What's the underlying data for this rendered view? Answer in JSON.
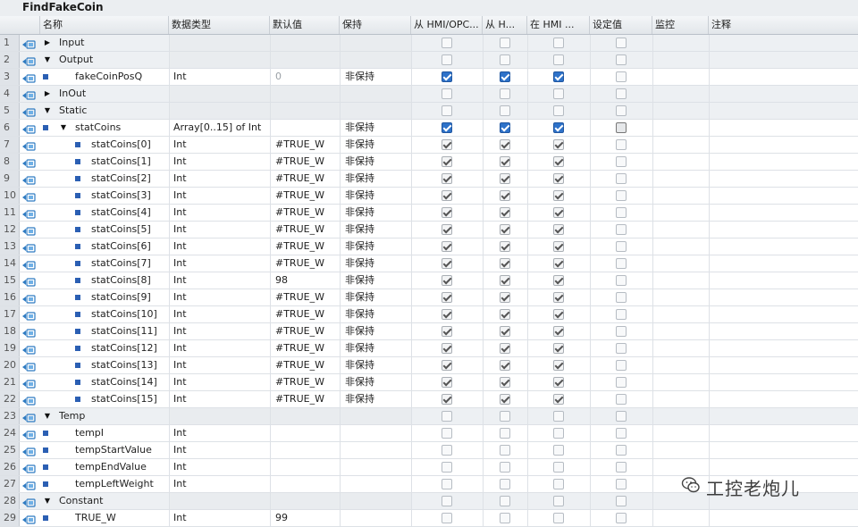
{
  "block_title": "FindFakeCoin",
  "headers": {
    "name": "名称",
    "data_type": "数据类型",
    "default": "默认值",
    "retain": "保持",
    "hmi_opc": "从 HMI/OPC...",
    "from_h": "从 H...",
    "in_hmi": "在 HMI ...",
    "setpoint": "设定值",
    "monitor": "监控",
    "comment": "注释"
  },
  "rows": [
    {
      "num": "1",
      "kind": "section",
      "toggle": "right",
      "name": "Input",
      "indent": 0,
      "type": "",
      "default": "",
      "retain": "",
      "hmi": "off",
      "fromh": "off",
      "inhmi": "off",
      "setpoint": "off"
    },
    {
      "num": "2",
      "kind": "section",
      "toggle": "down",
      "name": "Output",
      "indent": 0,
      "type": "",
      "default": "",
      "retain": "",
      "hmi": "off",
      "fromh": "off",
      "inhmi": "off",
      "setpoint": "off"
    },
    {
      "num": "3",
      "kind": "var",
      "toggle": "",
      "name": "fakeCoinPosQ",
      "indent": 1,
      "type": "Int",
      "default": "0",
      "default_grey": true,
      "retain": "非保持",
      "hmi": "on",
      "fromh": "on",
      "inhmi": "on",
      "setpoint": "off"
    },
    {
      "num": "4",
      "kind": "section",
      "toggle": "right",
      "name": "InOut",
      "indent": 0,
      "type": "",
      "default": "",
      "retain": "",
      "hmi": "off",
      "fromh": "off",
      "inhmi": "off",
      "setpoint": "off"
    },
    {
      "num": "5",
      "kind": "section",
      "toggle": "down",
      "name": "Static",
      "indent": 0,
      "type": "",
      "default": "",
      "retain": "",
      "hmi": "off",
      "fromh": "off",
      "inhmi": "off",
      "setpoint": "off"
    },
    {
      "num": "6",
      "kind": "var",
      "toggle": "down",
      "name": "statCoins",
      "indent": 1,
      "type": "Array[0..15] of Int",
      "default": "",
      "retain": "非保持",
      "hmi": "on",
      "fromh": "on",
      "inhmi": "on",
      "setpoint": "dark"
    },
    {
      "num": "7",
      "kind": "elem",
      "toggle": "",
      "name": "statCoins[0]",
      "indent": 2,
      "type": "Int",
      "default": "#TRUE_W",
      "retain": "非保持",
      "hmi": "grey",
      "fromh": "grey",
      "inhmi": "grey",
      "setpoint": "off"
    },
    {
      "num": "8",
      "kind": "elem",
      "toggle": "",
      "name": "statCoins[1]",
      "indent": 2,
      "type": "Int",
      "default": "#TRUE_W",
      "retain": "非保持",
      "hmi": "grey",
      "fromh": "grey",
      "inhmi": "grey",
      "setpoint": "off"
    },
    {
      "num": "9",
      "kind": "elem",
      "toggle": "",
      "name": "statCoins[2]",
      "indent": 2,
      "type": "Int",
      "default": "#TRUE_W",
      "retain": "非保持",
      "hmi": "grey",
      "fromh": "grey",
      "inhmi": "grey",
      "setpoint": "off"
    },
    {
      "num": "10",
      "kind": "elem",
      "toggle": "",
      "name": "statCoins[3]",
      "indent": 2,
      "type": "Int",
      "default": "#TRUE_W",
      "retain": "非保持",
      "hmi": "grey",
      "fromh": "grey",
      "inhmi": "grey",
      "setpoint": "off"
    },
    {
      "num": "11",
      "kind": "elem",
      "toggle": "",
      "name": "statCoins[4]",
      "indent": 2,
      "type": "Int",
      "default": "#TRUE_W",
      "retain": "非保持",
      "hmi": "grey",
      "fromh": "grey",
      "inhmi": "grey",
      "setpoint": "off"
    },
    {
      "num": "12",
      "kind": "elem",
      "toggle": "",
      "name": "statCoins[5]",
      "indent": 2,
      "type": "Int",
      "default": "#TRUE_W",
      "retain": "非保持",
      "hmi": "grey",
      "fromh": "grey",
      "inhmi": "grey",
      "setpoint": "off"
    },
    {
      "num": "13",
      "kind": "elem",
      "toggle": "",
      "name": "statCoins[6]",
      "indent": 2,
      "type": "Int",
      "default": "#TRUE_W",
      "retain": "非保持",
      "hmi": "grey",
      "fromh": "grey",
      "inhmi": "grey",
      "setpoint": "off"
    },
    {
      "num": "14",
      "kind": "elem",
      "toggle": "",
      "name": "statCoins[7]",
      "indent": 2,
      "type": "Int",
      "default": "#TRUE_W",
      "retain": "非保持",
      "hmi": "grey",
      "fromh": "grey",
      "inhmi": "grey",
      "setpoint": "off"
    },
    {
      "num": "15",
      "kind": "elem",
      "toggle": "",
      "name": "statCoins[8]",
      "indent": 2,
      "type": "Int",
      "default": "98",
      "retain": "非保持",
      "hmi": "grey",
      "fromh": "grey",
      "inhmi": "grey",
      "setpoint": "off"
    },
    {
      "num": "16",
      "kind": "elem",
      "toggle": "",
      "name": "statCoins[9]",
      "indent": 2,
      "type": "Int",
      "default": "#TRUE_W",
      "retain": "非保持",
      "hmi": "grey",
      "fromh": "grey",
      "inhmi": "grey",
      "setpoint": "off"
    },
    {
      "num": "17",
      "kind": "elem",
      "toggle": "",
      "name": "statCoins[10]",
      "indent": 2,
      "type": "Int",
      "default": "#TRUE_W",
      "retain": "非保持",
      "hmi": "grey",
      "fromh": "grey",
      "inhmi": "grey",
      "setpoint": "off"
    },
    {
      "num": "18",
      "kind": "elem",
      "toggle": "",
      "name": "statCoins[11]",
      "indent": 2,
      "type": "Int",
      "default": "#TRUE_W",
      "retain": "非保持",
      "hmi": "grey",
      "fromh": "grey",
      "inhmi": "grey",
      "setpoint": "off"
    },
    {
      "num": "19",
      "kind": "elem",
      "toggle": "",
      "name": "statCoins[12]",
      "indent": 2,
      "type": "Int",
      "default": "#TRUE_W",
      "retain": "非保持",
      "hmi": "grey",
      "fromh": "grey",
      "inhmi": "grey",
      "setpoint": "off"
    },
    {
      "num": "20",
      "kind": "elem",
      "toggle": "",
      "name": "statCoins[13]",
      "indent": 2,
      "type": "Int",
      "default": "#TRUE_W",
      "retain": "非保持",
      "hmi": "grey",
      "fromh": "grey",
      "inhmi": "grey",
      "setpoint": "off"
    },
    {
      "num": "21",
      "kind": "elem",
      "toggle": "",
      "name": "statCoins[14]",
      "indent": 2,
      "type": "Int",
      "default": "#TRUE_W",
      "retain": "非保持",
      "hmi": "grey",
      "fromh": "grey",
      "inhmi": "grey",
      "setpoint": "off"
    },
    {
      "num": "22",
      "kind": "elem",
      "toggle": "",
      "name": "statCoins[15]",
      "indent": 2,
      "type": "Int",
      "default": "#TRUE_W",
      "retain": "非保持",
      "hmi": "grey",
      "fromh": "grey",
      "inhmi": "grey",
      "setpoint": "off"
    },
    {
      "num": "23",
      "kind": "section",
      "toggle": "down",
      "name": "Temp",
      "indent": 0,
      "type": "",
      "default": "",
      "retain": "",
      "hmi": "off",
      "fromh": "off",
      "inhmi": "off",
      "setpoint": "off"
    },
    {
      "num": "24",
      "kind": "var",
      "toggle": "",
      "name": "tempI",
      "indent": 1,
      "type": "Int",
      "default": "",
      "retain": "",
      "hmi": "off",
      "fromh": "off",
      "inhmi": "off",
      "setpoint": "off"
    },
    {
      "num": "25",
      "kind": "var",
      "toggle": "",
      "name": "tempStartValue",
      "indent": 1,
      "type": "Int",
      "default": "",
      "retain": "",
      "hmi": "off",
      "fromh": "off",
      "inhmi": "off",
      "setpoint": "off"
    },
    {
      "num": "26",
      "kind": "var",
      "toggle": "",
      "name": "tempEndValue",
      "indent": 1,
      "type": "Int",
      "default": "",
      "retain": "",
      "hmi": "off",
      "fromh": "off",
      "inhmi": "off",
      "setpoint": "off"
    },
    {
      "num": "27",
      "kind": "var",
      "toggle": "",
      "name": "tempLeftWeight",
      "indent": 1,
      "type": "Int",
      "default": "",
      "retain": "",
      "hmi": "off",
      "fromh": "off",
      "inhmi": "off",
      "setpoint": "off"
    },
    {
      "num": "28",
      "kind": "section",
      "toggle": "down",
      "name": "Constant",
      "indent": 0,
      "type": "",
      "default": "",
      "retain": "",
      "hmi": "off",
      "fromh": "off",
      "inhmi": "off",
      "setpoint": "off",
      "editing": true
    },
    {
      "num": "29",
      "kind": "var",
      "toggle": "",
      "name": "TRUE_W",
      "indent": 1,
      "type": "Int",
      "default": "99",
      "retain": "",
      "hmi": "off",
      "fromh": "off",
      "inhmi": "off",
      "setpoint": "off"
    }
  ],
  "icons": {
    "interface_icon": "interface-icon",
    "expand": "chevron-right-icon",
    "collapse": "chevron-down-icon"
  },
  "watermark": "工控老炮儿",
  "colors": {
    "accent": "#2e72c9",
    "header_bg": "#e2e6ea",
    "band": "#edf0f3"
  }
}
